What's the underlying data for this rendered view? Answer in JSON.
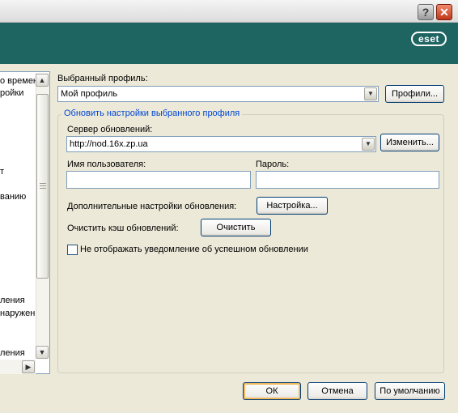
{
  "window": {
    "help_glyph": "?",
    "close_glyph": "✕",
    "brand_color": "#1e6562",
    "logo_text": "eset"
  },
  "tree": {
    "items": [
      "о времен",
      "ройки",
      "т",
      "ванию",
      "ления",
      "наружен",
      "ления"
    ]
  },
  "profile": {
    "label": "Выбранный профиль:",
    "selected": "Мой профиль",
    "profiles_button": "Профили..."
  },
  "update_group": {
    "title": "Обновить настройки выбранного профиля",
    "server_label": "Сервер обновлений:",
    "server_value": "http://nod.16x.zp.ua",
    "change_button": "Изменить...",
    "username_label": "Имя пользователя:",
    "username_value": "",
    "password_label": "Пароль:",
    "password_value": "",
    "advanced_label": "Дополнительные настройки обновления:",
    "advanced_button": "Настройка...",
    "clear_cache_label": "Очистить кэш обновлений:",
    "clear_cache_button": "Очистить",
    "no_notify_label": "Не отображать уведомление об успешном обновлении",
    "no_notify_checked": false
  },
  "footer": {
    "ok": "ОК",
    "cancel": "Отмена",
    "default": "По умолчанию"
  }
}
